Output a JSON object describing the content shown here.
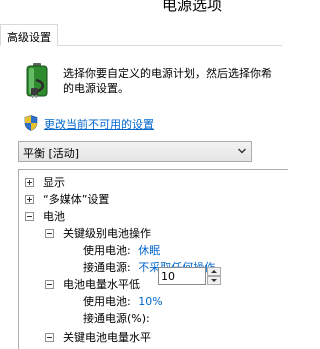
{
  "window": {
    "title": "电源选项"
  },
  "tabs": [
    {
      "label": "高级设置"
    }
  ],
  "intro": {
    "line1": "选择你要自定义的电源计划，然后选择你希",
    "line2": "的电源设置。"
  },
  "change_link": "更改当前不可用的设置",
  "plan_select": {
    "value": "平衡 [活动]"
  },
  "tree": {
    "display": "显示",
    "multimedia": "“多媒体”设置",
    "battery": "电池",
    "critical_action": {
      "label": "关键级别电池操作",
      "on_battery_label": "使用电池:",
      "on_battery_value": "休眠",
      "plugged_in_label": "接通电源:",
      "plugged_in_value": "不采取任何操作"
    },
    "low_level": {
      "label": "电池电量水平低",
      "on_battery_label": "使用电池:",
      "on_battery_value": "10%",
      "plugged_in_label": "接通电源(%):",
      "plugged_in_value": "10"
    },
    "critical_level": {
      "label": "关键电池电量水平"
    }
  },
  "colors": {
    "link": "#0066cc",
    "value": "#0066cc"
  }
}
